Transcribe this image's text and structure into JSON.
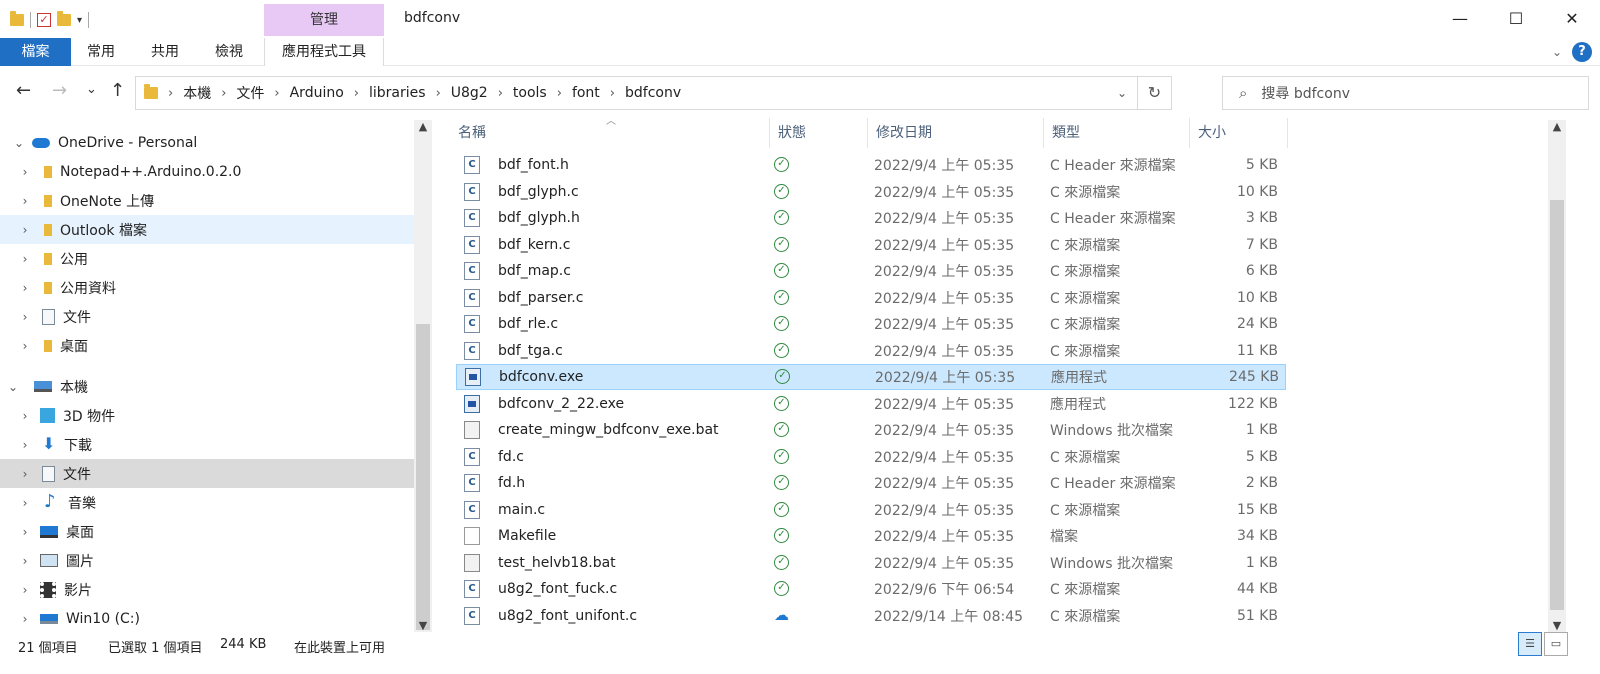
{
  "window": {
    "title": "bdfconv",
    "manage_label": "管理",
    "minimize": "—",
    "maximize": "☐",
    "close": "✕"
  },
  "ribbon": {
    "tabs": [
      "檔案",
      "常用",
      "共用",
      "檢視",
      "應用程式工具"
    ],
    "help": "?"
  },
  "nav": {
    "back": "←",
    "forward": "→",
    "recent": "⌄",
    "up": "↑",
    "breadcrumbs": [
      "本機",
      "文件",
      "Arduino",
      "libraries",
      "U8g2",
      "tools",
      "font",
      "bdfconv"
    ],
    "search_placeholder": "搜尋 bdfconv"
  },
  "sidebar": {
    "items": [
      {
        "label": "OneDrive - Personal",
        "icon": "cloud-icon",
        "expanded": true
      },
      {
        "label": "Notepad++.Arduino.0.2.0",
        "icon": "folder-icon"
      },
      {
        "label": "OneNote 上傳",
        "icon": "folder-icon"
      },
      {
        "label": "Outlook 檔案",
        "icon": "folder-icon"
      },
      {
        "label": "公用",
        "icon": "folder-icon"
      },
      {
        "label": "公用資料",
        "icon": "folder-icon"
      },
      {
        "label": "文件",
        "icon": "document-icon"
      },
      {
        "label": "桌面",
        "icon": "folder-icon"
      },
      {
        "label": "本機",
        "icon": "computer-icon",
        "expanded": true
      },
      {
        "label": "3D 物件",
        "icon": "cube-icon"
      },
      {
        "label": "下載",
        "icon": "download-icon"
      },
      {
        "label": "文件",
        "icon": "document-icon"
      },
      {
        "label": "音樂",
        "icon": "music-icon"
      },
      {
        "label": "桌面",
        "icon": "desktop-icon"
      },
      {
        "label": "圖片",
        "icon": "picture-icon"
      },
      {
        "label": "影片",
        "icon": "video-icon"
      },
      {
        "label": "Win10 (C:)",
        "icon": "drive-icon"
      }
    ]
  },
  "columns": {
    "name": "名稱",
    "status": "狀態",
    "modified": "修改日期",
    "type": "類型",
    "size": "大小"
  },
  "files": [
    {
      "name": "bdf_font.h",
      "icon": "c",
      "status": "ok",
      "date": "2022/9/4 上午 05:35",
      "type": "C Header 來源檔案",
      "size": "5 KB"
    },
    {
      "name": "bdf_glyph.c",
      "icon": "c",
      "status": "ok",
      "date": "2022/9/4 上午 05:35",
      "type": "C 來源檔案",
      "size": "10 KB"
    },
    {
      "name": "bdf_glyph.h",
      "icon": "c",
      "status": "ok",
      "date": "2022/9/4 上午 05:35",
      "type": "C Header 來源檔案",
      "size": "3 KB"
    },
    {
      "name": "bdf_kern.c",
      "icon": "c",
      "status": "ok",
      "date": "2022/9/4 上午 05:35",
      "type": "C 來源檔案",
      "size": "7 KB"
    },
    {
      "name": "bdf_map.c",
      "icon": "c",
      "status": "ok",
      "date": "2022/9/4 上午 05:35",
      "type": "C 來源檔案",
      "size": "6 KB"
    },
    {
      "name": "bdf_parser.c",
      "icon": "c",
      "status": "ok",
      "date": "2022/9/4 上午 05:35",
      "type": "C 來源檔案",
      "size": "10 KB"
    },
    {
      "name": "bdf_rle.c",
      "icon": "c",
      "status": "ok",
      "date": "2022/9/4 上午 05:35",
      "type": "C 來源檔案",
      "size": "24 KB"
    },
    {
      "name": "bdf_tga.c",
      "icon": "c",
      "status": "ok",
      "date": "2022/9/4 上午 05:35",
      "type": "C 來源檔案",
      "size": "11 KB"
    },
    {
      "name": "bdfconv.exe",
      "icon": "exe",
      "status": "ok",
      "date": "2022/9/4 上午 05:35",
      "type": "應用程式",
      "size": "245 KB",
      "selected": true
    },
    {
      "name": "bdfconv_2_22.exe",
      "icon": "exe",
      "status": "ok",
      "date": "2022/9/4 上午 05:35",
      "type": "應用程式",
      "size": "122 KB"
    },
    {
      "name": "create_mingw_bdfconv_exe.bat",
      "icon": "bat",
      "status": "ok",
      "date": "2022/9/4 上午 05:35",
      "type": "Windows 批次檔案",
      "size": "1 KB"
    },
    {
      "name": "fd.c",
      "icon": "c",
      "status": "ok",
      "date": "2022/9/4 上午 05:35",
      "type": "C 來源檔案",
      "size": "5 KB"
    },
    {
      "name": "fd.h",
      "icon": "c",
      "status": "ok",
      "date": "2022/9/4 上午 05:35",
      "type": "C Header 來源檔案",
      "size": "2 KB"
    },
    {
      "name": "main.c",
      "icon": "c",
      "status": "ok",
      "date": "2022/9/4 上午 05:35",
      "type": "C 來源檔案",
      "size": "15 KB"
    },
    {
      "name": "Makefile",
      "icon": "blank",
      "status": "ok",
      "date": "2022/9/4 上午 05:35",
      "type": "檔案",
      "size": "34 KB"
    },
    {
      "name": "test_helvb18.bat",
      "icon": "bat",
      "status": "ok",
      "date": "2022/9/4 上午 05:35",
      "type": "Windows 批次檔案",
      "size": "1 KB"
    },
    {
      "name": "u8g2_font_fuck.c",
      "icon": "c",
      "status": "ok",
      "date": "2022/9/6 下午 06:54",
      "type": "C 來源檔案",
      "size": "44 KB"
    },
    {
      "name": "u8g2_font_unifont.c",
      "icon": "c",
      "status": "cloud",
      "date": "2022/9/14 上午 08:45",
      "type": "C 來源檔案",
      "size": "51 KB"
    }
  ],
  "statusbar": {
    "count": "21 個項目",
    "selected": "已選取 1 個項目",
    "size": "244 KB",
    "availability": "在此裝置上可用"
  }
}
